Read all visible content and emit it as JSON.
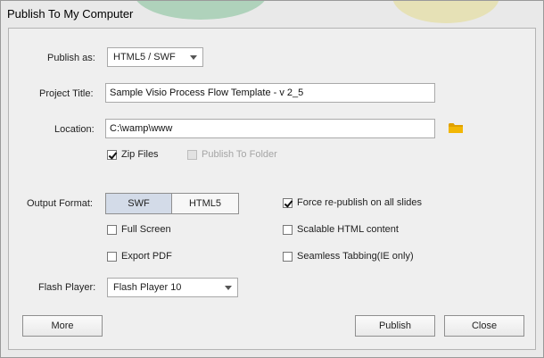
{
  "window": {
    "title": "Publish To My Computer"
  },
  "publish_as": {
    "label": "Publish as:",
    "value": "HTML5 / SWF"
  },
  "project_title": {
    "label": "Project Title:",
    "value": "Sample Visio Process Flow Template - v 2_5"
  },
  "location": {
    "label": "Location:",
    "value": "C:\\wamp\\www",
    "icon": "folder-icon",
    "icon_color": "#e0a100"
  },
  "options": {
    "zip_files": {
      "label": "Zip Files",
      "checked": true
    },
    "publish_to_folder": {
      "label": "Publish To Folder",
      "checked": false,
      "enabled": false
    }
  },
  "output_format": {
    "label": "Output Format:",
    "swf_label": "SWF",
    "html5_label": "HTML5",
    "selected": "SWF",
    "active_color": "#d3dbe8"
  },
  "checkboxes": {
    "full_screen": {
      "label": "Full Screen",
      "checked": false
    },
    "export_pdf": {
      "label": "Export PDF",
      "checked": false
    },
    "force_republish": {
      "label": "Force re-publish on all slides",
      "checked": true
    },
    "scalable_html": {
      "label": "Scalable HTML content",
      "checked": false
    },
    "seamless_tabbing": {
      "label": "Seamless Tabbing(IE only)",
      "checked": false
    }
  },
  "flash_player": {
    "label": "Flash Player:",
    "value": "Flash Player 10"
  },
  "buttons": {
    "more": "More",
    "publish": "Publish",
    "close": "Close"
  }
}
